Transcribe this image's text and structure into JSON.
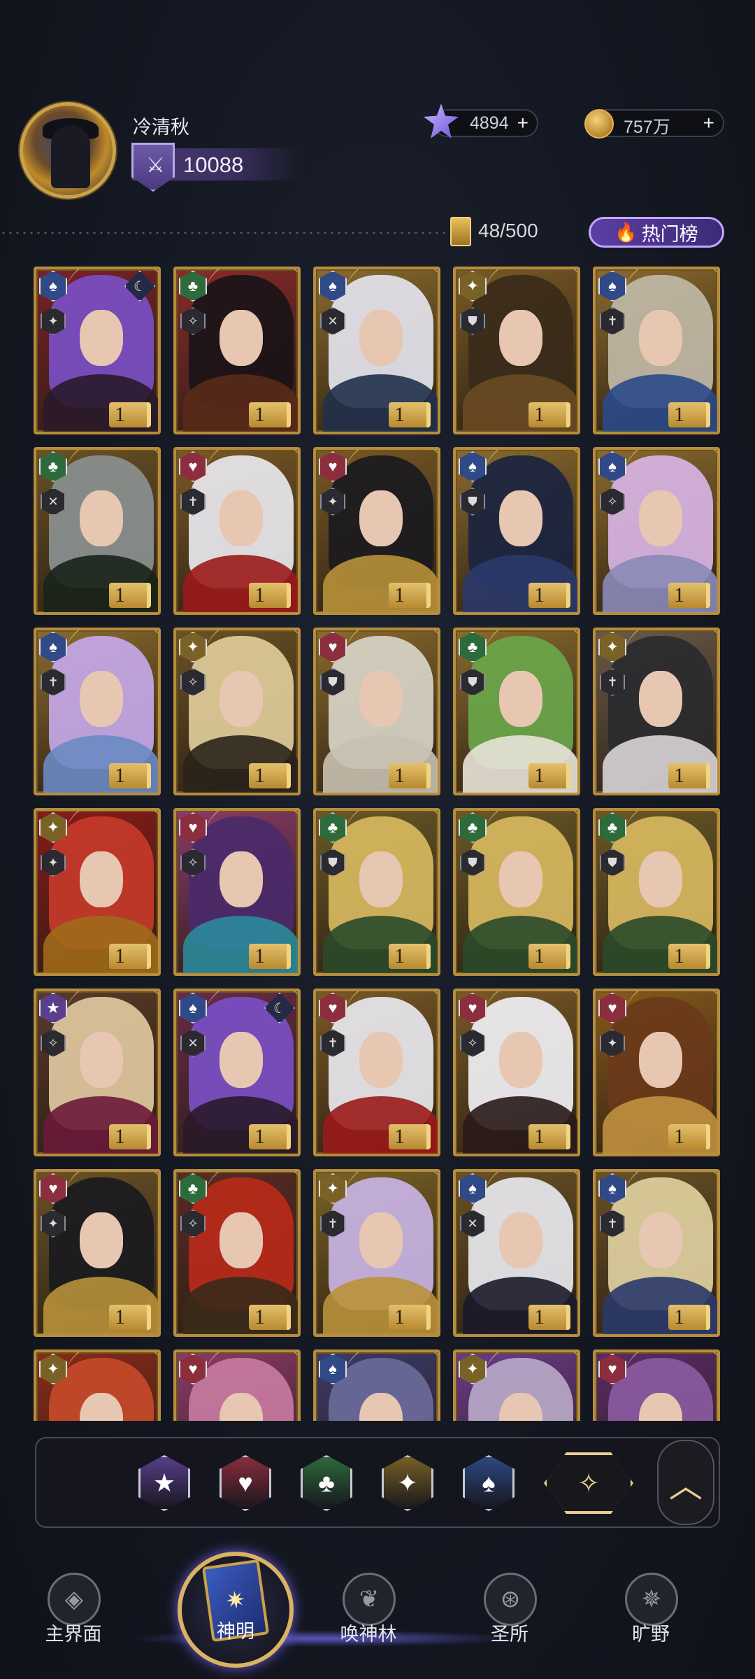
{
  "player": {
    "name": "冷清秋",
    "rank_value": "10088"
  },
  "currencies": {
    "gems": "4894",
    "gold": "757万",
    "add_symbol": "+"
  },
  "collection": {
    "count": "48/500",
    "hot_list_label": "热门榜"
  },
  "suit_colors": {
    "spade": "#2f4a86",
    "club": "#2e6b3c",
    "heart": "#8c2e3e",
    "diamond": "#7a6226",
    "star": "#5a3f8e"
  },
  "cards": [
    {
      "suit": "spade",
      "suit_glyph": "♠",
      "class_glyph": "✦",
      "level": "1",
      "bg": "#7a2228",
      "hair": "#7a4fc4",
      "robe": "#2a1a2a",
      "badge": "moon"
    },
    {
      "suit": "club",
      "suit_glyph": "♣",
      "class_glyph": "✧",
      "level": "1",
      "bg": "#8a2a2a",
      "hair": "#1a1418",
      "robe": "#5a2a1a",
      "badge": ""
    },
    {
      "suit": "spade",
      "suit_glyph": "♠",
      "class_glyph": "✕",
      "level": "1",
      "bg": "#8a6a2e",
      "hair": "#e4e4ee",
      "robe": "#20304a",
      "badge": ""
    },
    {
      "suit": "diamond",
      "suit_glyph": "✦",
      "class_glyph": "⛊",
      "level": "1",
      "bg": "#7a5a26",
      "hair": "#3a2a1a",
      "robe": "#6a4a24",
      "badge": ""
    },
    {
      "suit": "spade",
      "suit_glyph": "♠",
      "class_glyph": "✝",
      "level": "1",
      "bg": "#8a6a2e",
      "hair": "#c0b8a6",
      "robe": "#2a4a8a",
      "badge": ""
    },
    {
      "suit": "club",
      "suit_glyph": "♣",
      "class_glyph": "✕",
      "level": "1",
      "bg": "#6a5226",
      "hair": "#8a9090",
      "robe": "#1a2418",
      "badge": ""
    },
    {
      "suit": "heart",
      "suit_glyph": "♥",
      "class_glyph": "✝",
      "level": "1",
      "bg": "#7a5a26",
      "hair": "#e8e8ee",
      "robe": "#9a1a1a",
      "badge": ""
    },
    {
      "suit": "heart",
      "suit_glyph": "♥",
      "class_glyph": "✦",
      "level": "1",
      "bg": "#7a5a26",
      "hair": "#1a1a1e",
      "robe": "#b8913a",
      "badge": ""
    },
    {
      "suit": "spade",
      "suit_glyph": "♠",
      "class_glyph": "⛊",
      "level": "1",
      "bg": "#8a6a2e",
      "hair": "#1a2440",
      "robe": "#2a3a6a",
      "badge": ""
    },
    {
      "suit": "spade",
      "suit_glyph": "♠",
      "class_glyph": "✧",
      "level": "1",
      "bg": "#8a6a2e",
      "hair": "#d8b4e4",
      "robe": "#8a8ab8",
      "badge": ""
    },
    {
      "suit": "spade",
      "suit_glyph": "♠",
      "class_glyph": "✝",
      "level": "1",
      "bg": "#8a6a2e",
      "hair": "#c4a8e8",
      "robe": "#6a8ac4",
      "badge": ""
    },
    {
      "suit": "diamond",
      "suit_glyph": "✦",
      "class_glyph": "✧",
      "level": "1",
      "bg": "#6a5226",
      "hair": "#e0cc9a",
      "robe": "#2a241a",
      "badge": ""
    },
    {
      "suit": "heart",
      "suit_glyph": "♥",
      "class_glyph": "⛊",
      "level": "1",
      "bg": "#8a6a2e",
      "hair": "#d8d4c8",
      "robe": "#c8c0b0",
      "badge": ""
    },
    {
      "suit": "club",
      "suit_glyph": "♣",
      "class_glyph": "⛊",
      "level": "1",
      "bg": "#8a6a2e",
      "hair": "#6aa64a",
      "robe": "#e8e4d8",
      "badge": ""
    },
    {
      "suit": "diamond",
      "suit_glyph": "✦",
      "class_glyph": "✝",
      "level": "1",
      "bg": "#6a5a4a",
      "hair": "#2a2a2e",
      "robe": "#d8d4d8",
      "badge": ""
    },
    {
      "suit": "diamond",
      "suit_glyph": "✦",
      "class_glyph": "✦",
      "level": "1",
      "bg": "#8a1a1a",
      "hair": "#c43a2a",
      "robe": "#a06a1a",
      "badge": ""
    },
    {
      "suit": "heart",
      "suit_glyph": "♥",
      "class_glyph": "✧",
      "level": "1",
      "bg": "#8a3a6a",
      "hair": "#4a2a6a",
      "robe": "#2a8a9a",
      "badge": ""
    },
    {
      "suit": "club",
      "suit_glyph": "♣",
      "class_glyph": "⛊",
      "level": "1",
      "bg": "#6a5a26",
      "hair": "#d8b860",
      "robe": "#2a4a2a",
      "badge": ""
    },
    {
      "suit": "club",
      "suit_glyph": "♣",
      "class_glyph": "⛊",
      "level": "1",
      "bg": "#6a5a26",
      "hair": "#d8b860",
      "robe": "#2a4a2a",
      "badge": ""
    },
    {
      "suit": "club",
      "suit_glyph": "♣",
      "class_glyph": "⛊",
      "level": "1",
      "bg": "#6a5a26",
      "hair": "#d8b860",
      "robe": "#2a4a2a",
      "badge": ""
    },
    {
      "suit": "star",
      "suit_glyph": "★",
      "class_glyph": "✧",
      "level": "1",
      "bg": "#5a3a2a",
      "hair": "#e0c8a0",
      "robe": "#6a1a3a",
      "badge": ""
    },
    {
      "suit": "spade",
      "suit_glyph": "♠",
      "class_glyph": "✕",
      "level": "1",
      "bg": "#6a2a4a",
      "hair": "#7a4fc4",
      "robe": "#2a1a2a",
      "badge": "moon"
    },
    {
      "suit": "heart",
      "suit_glyph": "♥",
      "class_glyph": "✝",
      "level": "1",
      "bg": "#7a5a26",
      "hair": "#e8e8ee",
      "robe": "#9a1a1a",
      "badge": ""
    },
    {
      "suit": "heart",
      "suit_glyph": "♥",
      "class_glyph": "✧",
      "level": "1",
      "bg": "#7a5a26",
      "hair": "#f0f0f4",
      "robe": "#2a1a1a",
      "badge": ""
    },
    {
      "suit": "heart",
      "suit_glyph": "♥",
      "class_glyph": "✦",
      "level": "1",
      "bg": "#8a5a1a",
      "hair": "#6a3a1a",
      "robe": "#c09040",
      "badge": ""
    },
    {
      "suit": "heart",
      "suit_glyph": "♥",
      "class_glyph": "✦",
      "level": "1",
      "bg": "#6a5226",
      "hair": "#1a1a1e",
      "robe": "#b8913a",
      "badge": ""
    },
    {
      "suit": "club",
      "suit_glyph": "♣",
      "class_glyph": "✧",
      "level": "1",
      "bg": "#5a2a24",
      "hair": "#b82a1a",
      "robe": "#3a2a1a",
      "badge": ""
    },
    {
      "suit": "diamond",
      "suit_glyph": "✦",
      "class_glyph": "✝",
      "level": "1",
      "bg": "#7a6226",
      "hair": "#c8b4e4",
      "robe": "#b8913a",
      "badge": ""
    },
    {
      "suit": "spade",
      "suit_glyph": "♠",
      "class_glyph": "✕",
      "level": "1",
      "bg": "#6a5226",
      "hair": "#e8e8ee",
      "robe": "#1a1a2a",
      "badge": ""
    },
    {
      "suit": "spade",
      "suit_glyph": "♠",
      "class_glyph": "✝",
      "level": "1",
      "bg": "#6a5226",
      "hair": "#e0d0a0",
      "robe": "#2a3a6a",
      "badge": ""
    },
    {
      "suit": "diamond",
      "suit_glyph": "✦",
      "class_glyph": "",
      "level": "",
      "bg": "#8a2a1a",
      "hair": "#c44a2a",
      "robe": "#a06a1a",
      "badge": ""
    },
    {
      "suit": "heart",
      "suit_glyph": "♥",
      "class_glyph": "",
      "level": "",
      "bg": "#8a3a6a",
      "hair": "#c87aa0",
      "robe": "#2a8a9a",
      "badge": ""
    },
    {
      "suit": "spade",
      "suit_glyph": "♠",
      "class_glyph": "",
      "level": "",
      "bg": "#3a3a6a",
      "hair": "#6a6a9a",
      "robe": "#2a2a4a",
      "badge": ""
    },
    {
      "suit": "diamond",
      "suit_glyph": "✦",
      "class_glyph": "",
      "level": "",
      "bg": "#6a3a8a",
      "hair": "#b8a8c8",
      "robe": "#4a2a6a",
      "badge": ""
    },
    {
      "suit": "heart",
      "suit_glyph": "♥",
      "class_glyph": "",
      "level": "",
      "bg": "#5a2a6a",
      "hair": "#8a5aa0",
      "robe": "#3a1a4a",
      "badge": ""
    }
  ],
  "filters": [
    {
      "name": "star",
      "glyph": "★",
      "color": "#5a3f8e"
    },
    {
      "name": "heart",
      "glyph": "♥",
      "color": "#8c2e3e"
    },
    {
      "name": "club",
      "glyph": "♣",
      "color": "#2e6b3c"
    },
    {
      "name": "diamond",
      "glyph": "✦",
      "color": "#7a6226"
    },
    {
      "name": "spade",
      "glyph": "♠",
      "color": "#2f4a86"
    }
  ],
  "filter_all_glyph": "✧",
  "collapse_glyph": "︿",
  "nav": {
    "main_world": "主界面",
    "deities": "神明",
    "summon_forest": "唤神林",
    "sanctuary": "圣所",
    "wilds": "旷野"
  }
}
